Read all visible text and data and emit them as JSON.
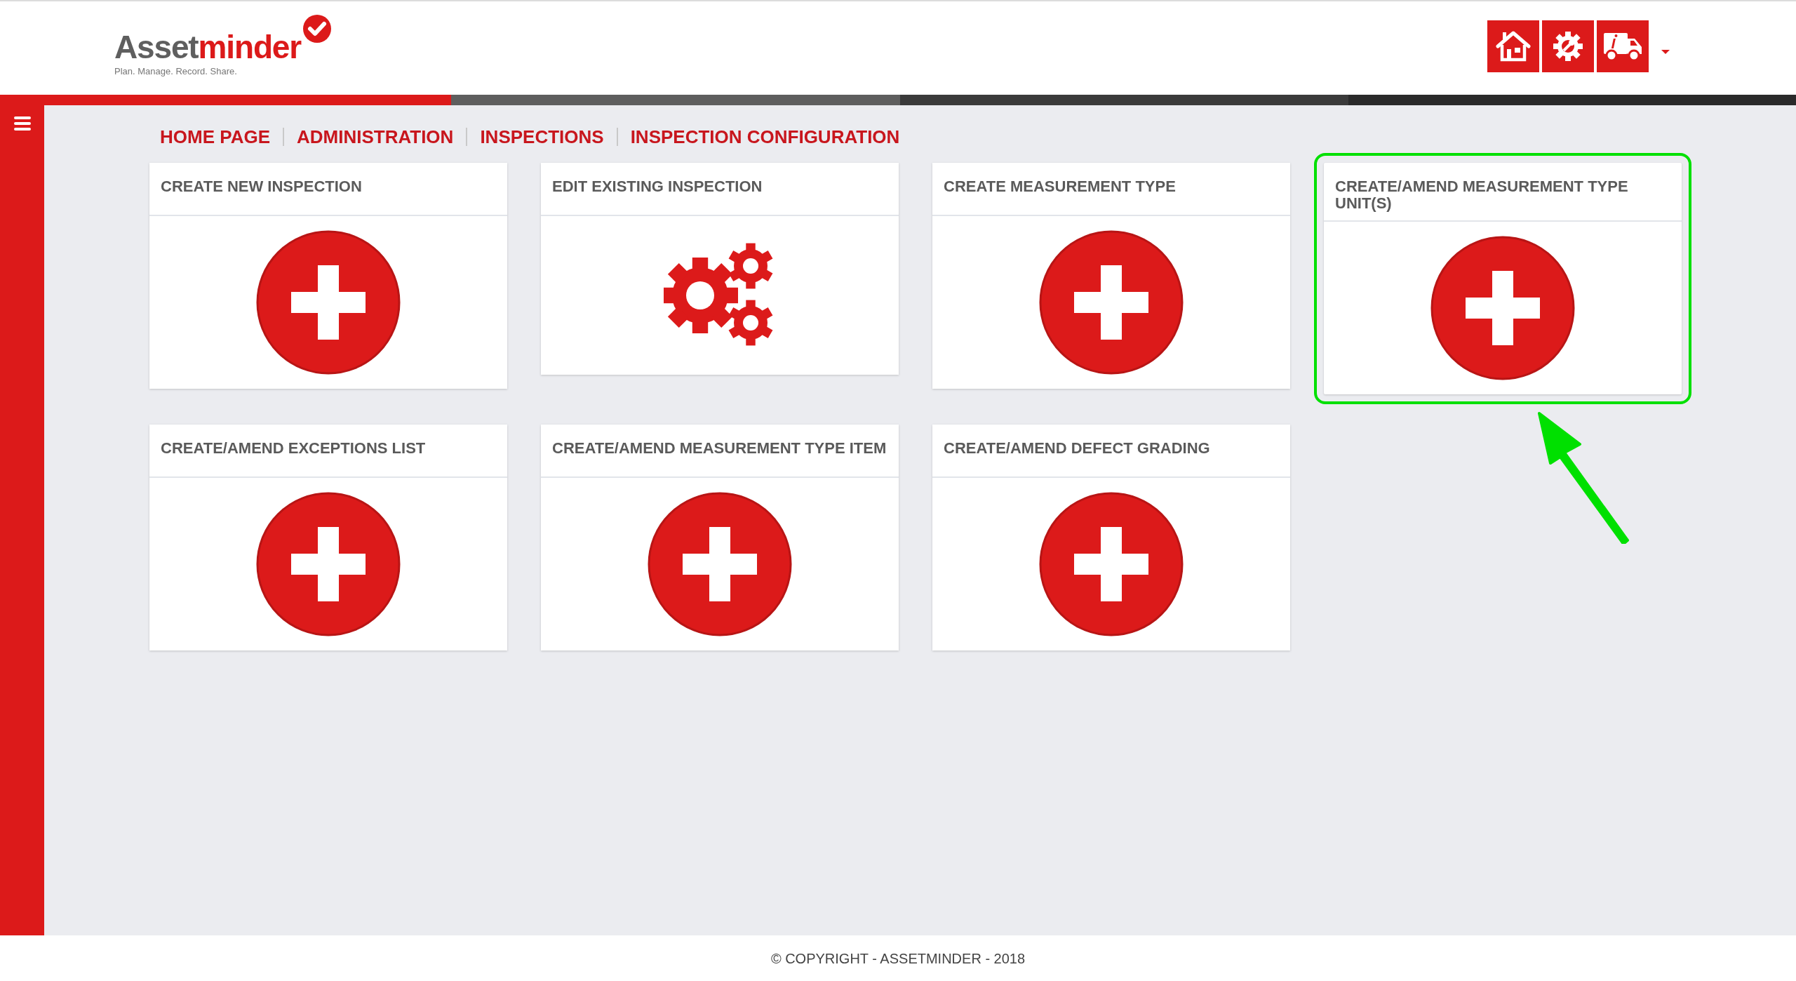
{
  "header": {
    "logo": {
      "name_part1": "Asset",
      "name_part2": "minder",
      "tagline": "Plan. Manage. Record. Share."
    },
    "toolbar": [
      {
        "kind": "home"
      },
      {
        "kind": "settings"
      },
      {
        "kind": "truck"
      }
    ],
    "dropdown": {
      "kind": "caret"
    }
  },
  "breadcrumb": [
    {
      "label": "HOME PAGE"
    },
    {
      "label": "ADMINISTRATION"
    },
    {
      "label": "INSPECTIONS"
    },
    {
      "label": "INSPECTION CONFIGURATION"
    }
  ],
  "cards": [
    {
      "title": "CREATE NEW INSPECTION",
      "kind": "plus",
      "highlighted": false
    },
    {
      "title": "EDIT EXISTING INSPECTION",
      "kind": "gears",
      "highlighted": false
    },
    {
      "title": "CREATE MEASUREMENT TYPE",
      "kind": "plus",
      "highlighted": false
    },
    {
      "title": "CREATE/AMEND MEASUREMENT TYPE UNIT(S)",
      "kind": "plus",
      "highlighted": true
    },
    {
      "title": "CREATE/AMEND EXCEPTIONS LIST",
      "kind": "plus",
      "highlighted": false
    },
    {
      "title": "CREATE/AMEND MEASUREMENT TYPE ITEM",
      "kind": "plus",
      "highlighted": false
    },
    {
      "title": "CREATE/AMEND DEFECT GRADING",
      "kind": "plus",
      "highlighted": false
    }
  ],
  "footer": "© COPYRIGHT - ASSETMINDER - 2018"
}
